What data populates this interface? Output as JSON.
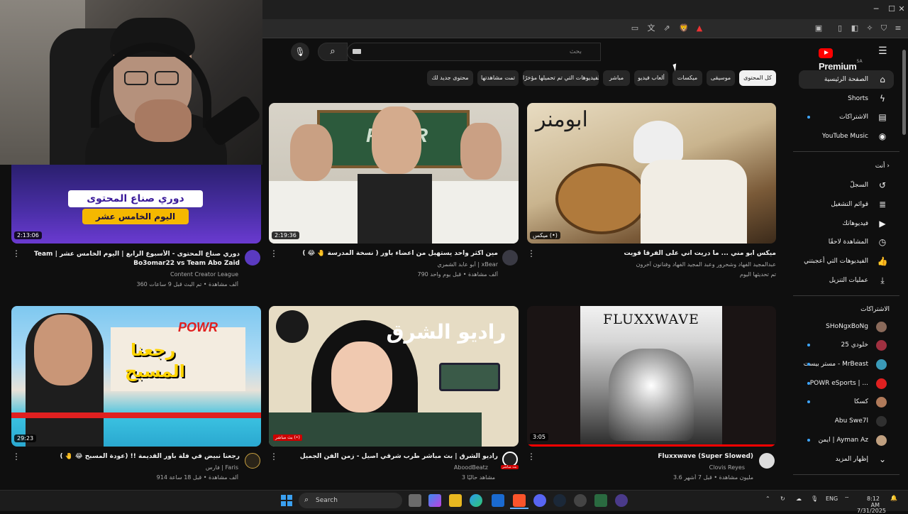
{
  "browser": {
    "window_controls": [
      "─",
      "☐",
      "✕"
    ],
    "address_icons": [
      "▭",
      "文",
      "⇗",
      "🦁",
      "▲",
      "▣",
      "▯",
      "◧",
      "✧",
      "⛉",
      "≡"
    ]
  },
  "header": {
    "logo_text": "Premium",
    "logo_sup": "SA",
    "search_placeholder": "بحث",
    "search_icon": "⌕",
    "mic_icon": "🎙",
    "menu_icon": "☰"
  },
  "chips": [
    {
      "label": "كل المحتوى",
      "active": true
    },
    {
      "label": "موسيقى",
      "active": false
    },
    {
      "label": "ميكسات",
      "active": false
    },
    {
      "label": "ألعاب فيديو",
      "active": false
    },
    {
      "label": "مباشر",
      "active": false
    },
    {
      "label": "الفيديوهات التي تم تحميلها مؤخرًا",
      "active": false
    },
    {
      "label": "تمت مشاهدتها",
      "active": false
    },
    {
      "label": "محتوى جديد لك",
      "active": false
    }
  ],
  "sidebar": {
    "main": [
      {
        "label": "الصفحة الرئيسية",
        "icon": "⌂",
        "active": true
      },
      {
        "label": "Shorts",
        "icon": "ϟ"
      },
      {
        "label": "الاشتراكات",
        "icon": "▤"
      },
      {
        "label": "YouTube Music",
        "icon": "◉"
      }
    ],
    "you_header": "أنت  ›",
    "you": [
      {
        "label": "السجلّ",
        "icon": "↺"
      },
      {
        "label": "قوائم التشغيل",
        "icon": "≣"
      },
      {
        "label": "فيديوهاتك",
        "icon": "▶"
      },
      {
        "label": "المشاهدة لاحقًا",
        "icon": "◷"
      },
      {
        "label": "الفيديوهات التي أعجبتني",
        "icon": "👍"
      },
      {
        "label": "عمليات التنزيل",
        "icon": "⤓"
      }
    ],
    "subs_header": "الاشتراكات",
    "subs": [
      {
        "label": "SHoNgxBoNg",
        "color": "#8a6a5a"
      },
      {
        "label": "خلودي 25",
        "color": "#a03040"
      },
      {
        "label": "مستر بيست - MrBeast",
        "color": "#3a9ab8"
      },
      {
        "label": "POWR eSports | ...",
        "color": "#e02020"
      },
      {
        "label": "كسكا",
        "color": "#b07a5a"
      },
      {
        "label": "Abu Swe7l",
        "color": "#303030"
      },
      {
        "label": "ايمن | Ayman Az",
        "color": "#c0a080"
      }
    ],
    "show_more": "إظهار المزيد",
    "show_more_icon": "⌄"
  },
  "videos": [
    {
      "title": "ميكس ابو مني ... ما دريت اني على الفرقا قويت",
      "channel": "عبدالمجيد الفهاد وشحرور وعبد المجيد الفهاد وفنانون آخرون",
      "meta": "تم تحديثها اليوم",
      "duration": "ميكس (•)",
      "avatar": ""
    },
    {
      "title": "مين اكثر واحد يستهبل من اعضاء باور ( نسخة المدرسة 🤚 😂 )",
      "channel": "أبو عابد الشمري | xBear",
      "meta": "790 ألف مشاهدة • قبل يوم واحد",
      "duration": "2:19:36"
    },
    {
      "title": "دوري صناع المحتوى - الأسبوع الرابع | اليوم الخامس عشر | Team Bo3omar22 vs Team Abo Zaid",
      "channel": "Content Creator League",
      "meta": "360 ألف مشاهدة • تم البث قبل 9 ساعات",
      "duration": "2:13:06"
    },
    {
      "title": "Fluxxwave (Super Slowed)",
      "channel": "Clovis Reyes",
      "meta": "3.6 مليون مشاهدة • قبل 7 أشهر",
      "duration": "3:05"
    },
    {
      "title": "راديو الشرق | بث مباشر طرب شرقي أصيل - زمن الفن الجميل",
      "channel": "AboodBeatz",
      "meta": "3 مشاهد حاليًا",
      "duration": "بث مباشر (•)"
    },
    {
      "title": "رجعنا نبيض في فلة باور القديمة !! (عودة المسبح 😂 🤚 )",
      "channel": "فارس | Faris",
      "meta": "914 ألف مشاهدة • قبل 18 ساعة",
      "duration": "29:23"
    }
  ],
  "thumb_text": {
    "v1": "ابومنر",
    "v2": "POWR",
    "v3_line1": "دوري صناع المحتوى",
    "v3_line2": "اليوم الخامس عشر",
    "v4": "FLUXXWAVE",
    "v5": "راديو الشرق",
    "v6_line1": "رجعنا",
    "v6_line2": "المسبح"
  },
  "taskbar": {
    "search_label": "Search",
    "lang": "ENG",
    "time": "8:12 AM",
    "date": "7/31/2025"
  }
}
